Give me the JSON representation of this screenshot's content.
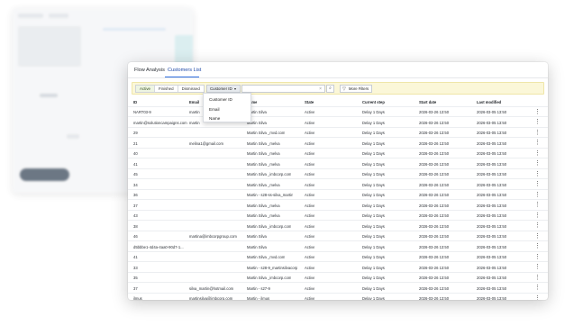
{
  "tabs": [
    "Flow Analysis",
    "Customers List"
  ],
  "toolbar": {
    "status_segments": [
      "Active",
      "Finished",
      "Dismissed"
    ],
    "filter_field": "Customer ID",
    "search_value": "",
    "more_filters_label": "More Filters"
  },
  "dropdown_options": [
    "Customer ID",
    "Email",
    "Name"
  ],
  "columns": [
    "ID",
    "Email",
    "Name",
    "State",
    "Current step",
    "Start date",
    "Last modified"
  ],
  "rows": [
    [
      "NART03-9",
      "martin",
      "Martin Silva",
      "Active",
      "Delay 1 Days",
      "2026-03-26 13:50",
      "2026-03-05 13:50"
    ],
    [
      "martin@solutioncampaigns.com",
      "martin",
      "Martin Silva",
      "Active",
      "Delay 1 Days",
      "2026-03-26 13:50",
      "2026-03-05 13:50"
    ],
    [
      "29",
      "",
      "Martin Silva _mvd.com",
      "Active",
      "Delay 1 Days",
      "2026-03-26 13:50",
      "2026-03-05 13:50"
    ],
    [
      "21",
      "melina1@gmail.com",
      "Martin Silva _melva",
      "Active",
      "Delay 1 Days",
      "2026-03-26 13:50",
      "2026-03-05 13:50"
    ],
    [
      "40",
      "",
      "Martin Silva _melva",
      "Active",
      "Delay 1 Days",
      "2026-03-26 13:50",
      "2026-03-05 13:50"
    ],
    [
      "41",
      "",
      "Martin Silva _melva",
      "Active",
      "Delay 1 Days",
      "2026-03-26 13:50",
      "2026-03-05 13:50"
    ],
    [
      "45",
      "",
      "Martin Silva _imbcorp.com",
      "Active",
      "Delay 1 Days",
      "2026-03-26 13:50",
      "2026-03-05 13:50"
    ],
    [
      "34",
      "",
      "Martin Silva _melva",
      "Active",
      "Delay 1 Days",
      "2026-03-26 13:50",
      "2026-03-05 13:50"
    ],
    [
      "36",
      "",
      "Martin - s28-ss-silva_martin",
      "Active",
      "Delay 1 Days",
      "2026-03-26 13:50",
      "2026-03-05 13:50"
    ],
    [
      "37",
      "",
      "Martin Silva _melva",
      "Active",
      "Delay 1 Days",
      "2026-03-26 13:50",
      "2026-03-05 13:50"
    ],
    [
      "43",
      "",
      "Martin Silva _melva",
      "Active",
      "Delay 1 Days",
      "2026-03-26 13:50",
      "2026-03-05 13:50"
    ],
    [
      "38",
      "",
      "Martin Silva _imbcorp.com",
      "Active",
      "Delay 1 Days",
      "2026-03-26 13:50",
      "2026-03-05 13:50"
    ],
    [
      "46",
      "martina@imbcorpgroup.com",
      "Martin Silva",
      "Active",
      "Delay 1 Days",
      "2026-03-26 13:50",
      "2026-03-05 13:50"
    ],
    [
      "d5bbbe1-4d4a-4aa0-90d7-1...",
      "",
      "Martin Silva",
      "Active",
      "Delay 1 Days",
      "2026-03-26 13:50",
      "2026-03-05 13:50"
    ],
    [
      "41",
      "",
      "Martin Silva _mvd.com",
      "Active",
      "Delay 1 Days",
      "2026-03-26 13:50",
      "2026-03-05 13:50"
    ],
    [
      "33",
      "",
      "Martin - s28-9_martinsilvacorp",
      "Active",
      "Delay 1 Days",
      "2026-03-26 13:50",
      "2026-03-05 13:50"
    ],
    [
      "35",
      "",
      "Martin Silva _imbcorp.com",
      "Active",
      "Delay 1 Days",
      "2026-03-26 13:50",
      "2026-03-05 13:50"
    ],
    [
      "37",
      "silva_martin@hotmail.com",
      "Martin - s27-9",
      "Active",
      "Delay 1 Days",
      "2026-03-26 13:50",
      "2026-03-05 13:50"
    ],
    [
      "ilmus",
      "martinsilva@imbcorp.com",
      "Martin - ilmus",
      "Active",
      "Delay 1 Days",
      "2026-03-26 13:50",
      "2026-03-05 13:50"
    ]
  ],
  "colors": {
    "accent": "#2f6fe0",
    "toolbar_bg": "#fbf7d8"
  }
}
